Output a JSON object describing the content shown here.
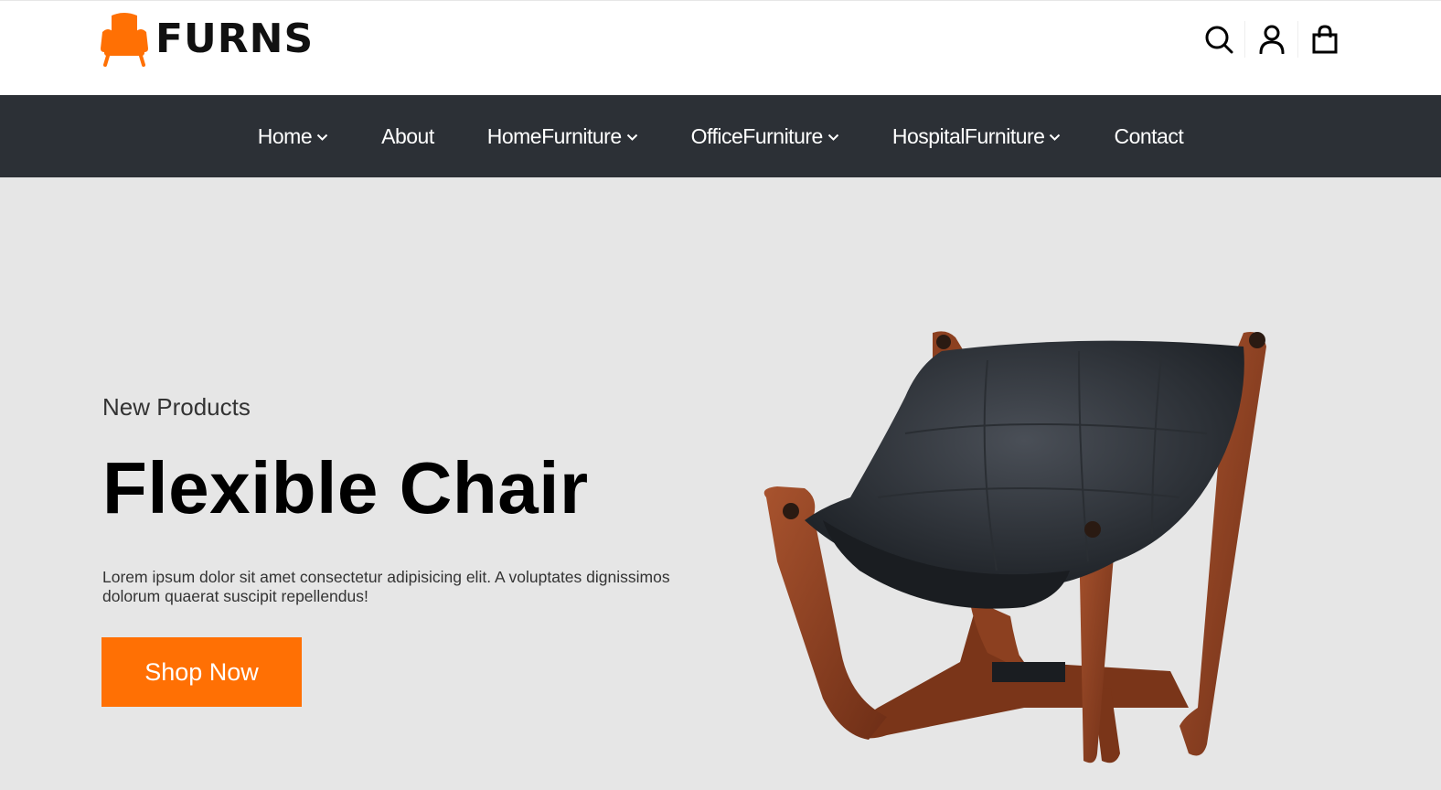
{
  "header": {
    "logo_text": "FURNS",
    "icons": [
      "search-icon",
      "user-icon",
      "shopping-bag-icon"
    ]
  },
  "nav": {
    "items": [
      {
        "label": "Home",
        "has_dropdown": true
      },
      {
        "label": "About",
        "has_dropdown": false
      },
      {
        "label": "HomeFurniture",
        "has_dropdown": true
      },
      {
        "label": "OfficeFurniture",
        "has_dropdown": true
      },
      {
        "label": "HospitalFurniture",
        "has_dropdown": true
      },
      {
        "label": "Contact",
        "has_dropdown": false
      }
    ]
  },
  "hero": {
    "eyebrow": "New Products",
    "title": "Flexible Chair",
    "description": "Lorem ipsum dolor sit amet consectetur adipisicing elit. A voluptates dignissimos dolorum quaerat suscipit repellendus!",
    "cta_label": "Shop Now"
  },
  "colors": {
    "accent": "#ff7004",
    "nav_bg": "#2c3036",
    "hero_bg": "#e6e6e6"
  }
}
